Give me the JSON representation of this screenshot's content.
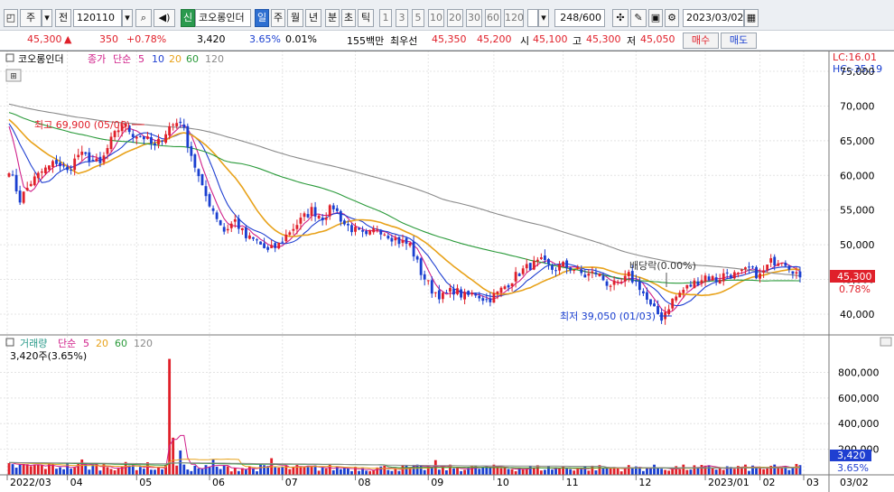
{
  "toolbar": {
    "market_type": "주",
    "prev_label": "전",
    "code": "120110",
    "trust_label": "신",
    "stock_name": "코오롱인더",
    "periods": [
      "일",
      "주",
      "월",
      "년",
      "분",
      "초",
      "틱"
    ],
    "active_period": "일",
    "intervals": [
      "1",
      "3",
      "5",
      "10",
      "20",
      "30",
      "60",
      "120"
    ],
    "count": "248/600",
    "date": "2023/03/02"
  },
  "quote": {
    "price": "45,300",
    "arrow": "▲",
    "change": "350",
    "change_pct": "+0.78%",
    "volume": "3,420",
    "volume_ratio": "3.65%",
    "turnover_pct": "0.01%",
    "trade_value": "155백만",
    "best_label": "최우선",
    "ask": "45,350",
    "bid": "45,200",
    "open_label": "시",
    "open": "45,100",
    "high_label": "고",
    "high": "45,300",
    "low_label": "저",
    "low": "45,050",
    "buy_button": "매수",
    "sell_button": "매도"
  },
  "price_panel": {
    "legend": {
      "name": "코오롱인더",
      "close_label": "종가",
      "ma_label": "단순",
      "ma_periods": [
        "5",
        "10",
        "20",
        "60",
        "120"
      ]
    },
    "lc": "LC:16.01",
    "hc": "HC:-35.19",
    "y_ticks": [
      "75,000",
      "70,000",
      "65,000",
      "60,000",
      "55,000",
      "50,000",
      "45,000",
      "40,000"
    ],
    "current_price": "45,300",
    "current_pct": "0.78%",
    "annotations": {
      "high": "최고 69,900 (05/06)",
      "low": "최저 39,050 (01/03)",
      "dividend": "배당락(0.00%)"
    }
  },
  "volume_panel": {
    "legend": {
      "label": "거래량",
      "ma_label": "단순",
      "ma_periods": [
        "5",
        "20",
        "60",
        "120"
      ]
    },
    "current_volume_text": "3,420주(3.65%)",
    "y_ticks": [
      "800,000",
      "600,000",
      "400,000",
      "200,000"
    ],
    "current_volume": "3,420",
    "current_pct": "3.65%"
  },
  "x_axis": {
    "ticks": [
      "2022/03",
      "04",
      "05",
      "06",
      "07",
      "08",
      "09",
      "10",
      "11",
      "12",
      "2023/01",
      "02",
      "03"
    ],
    "last_date": "03/02"
  },
  "colors": {
    "up": "#e0202a",
    "down": "#1a3fd0",
    "ma5": "#d0208a",
    "ma10": "#1f3fd1",
    "ma20": "#e8a21a",
    "ma60": "#2a9a3a",
    "ma120": "#8a8a8a"
  },
  "chart_data": {
    "type": "candlestick",
    "x": [
      "2022/03",
      "04",
      "05",
      "06",
      "07",
      "08",
      "09",
      "10",
      "11",
      "12",
      "2023/01",
      "02",
      "03"
    ],
    "price_ylim": [
      37000,
      78000
    ],
    "volume_ylim": [
      0,
      930000
    ],
    "close_anchors": [
      {
        "t": 0,
        "v": 61000
      },
      {
        "t": 3,
        "v": 56500
      },
      {
        "t": 6,
        "v": 59000
      },
      {
        "t": 9,
        "v": 60500
      },
      {
        "t": 13,
        "v": 62000
      },
      {
        "t": 16,
        "v": 60500
      },
      {
        "t": 19,
        "v": 63000
      },
      {
        "t": 22,
        "v": 62500
      },
      {
        "t": 25,
        "v": 61500
      },
      {
        "t": 28,
        "v": 65000
      },
      {
        "t": 31,
        "v": 67500
      },
      {
        "t": 34,
        "v": 66000
      },
      {
        "t": 37,
        "v": 65500
      },
      {
        "t": 40,
        "v": 64000
      },
      {
        "t": 44,
        "v": 67000
      },
      {
        "t": 47,
        "v": 68000
      },
      {
        "t": 50,
        "v": 63000
      },
      {
        "t": 53,
        "v": 58000
      },
      {
        "t": 56,
        "v": 55000
      },
      {
        "t": 59,
        "v": 52000
      },
      {
        "t": 62,
        "v": 53500
      },
      {
        "t": 65,
        "v": 51000
      },
      {
        "t": 68,
        "v": 50500
      },
      {
        "t": 71,
        "v": 49000
      },
      {
        "t": 74,
        "v": 50000
      },
      {
        "t": 77,
        "v": 52000
      },
      {
        "t": 80,
        "v": 53500
      },
      {
        "t": 83,
        "v": 55000
      },
      {
        "t": 86,
        "v": 54000
      },
      {
        "t": 89,
        "v": 55500
      },
      {
        "t": 92,
        "v": 53000
      },
      {
        "t": 95,
        "v": 52000
      },
      {
        "t": 98,
        "v": 51000
      },
      {
        "t": 101,
        "v": 52500
      },
      {
        "t": 104,
        "v": 51500
      },
      {
        "t": 107,
        "v": 50500
      },
      {
        "t": 110,
        "v": 50000
      },
      {
        "t": 113,
        "v": 46000
      },
      {
        "t": 116,
        "v": 43500
      },
      {
        "t": 119,
        "v": 42500
      },
      {
        "t": 122,
        "v": 43500
      },
      {
        "t": 125,
        "v": 42500
      },
      {
        "t": 128,
        "v": 43000
      },
      {
        "t": 131,
        "v": 42000
      },
      {
        "t": 134,
        "v": 43000
      },
      {
        "t": 137,
        "v": 44500
      },
      {
        "t": 140,
        "v": 46000
      },
      {
        "t": 143,
        "v": 47000
      },
      {
        "t": 146,
        "v": 47500
      },
      {
        "t": 149,
        "v": 46500
      },
      {
        "t": 152,
        "v": 47000
      },
      {
        "t": 155,
        "v": 46500
      },
      {
        "t": 158,
        "v": 45500
      },
      {
        "t": 161,
        "v": 46000
      },
      {
        "t": 164,
        "v": 44500
      },
      {
        "t": 167,
        "v": 44000
      },
      {
        "t": 170,
        "v": 45500
      },
      {
        "t": 173,
        "v": 44000
      },
      {
        "t": 176,
        "v": 41000
      },
      {
        "t": 179,
        "v": 39500
      },
      {
        "t": 182,
        "v": 42000
      },
      {
        "t": 185,
        "v": 43500
      },
      {
        "t": 188,
        "v": 44500
      },
      {
        "t": 191,
        "v": 45500
      },
      {
        "t": 194,
        "v": 45000
      },
      {
        "t": 197,
        "v": 46000
      },
      {
        "t": 200,
        "v": 45500
      },
      {
        "t": 203,
        "v": 46500
      },
      {
        "t": 206,
        "v": 45500
      },
      {
        "t": 209,
        "v": 47500
      },
      {
        "t": 212,
        "v": 48000
      },
      {
        "t": 215,
        "v": 46500
      },
      {
        "t": 217,
        "v": 45300
      }
    ],
    "sessions": 218,
    "volume_peak": {
      "t": 44,
      "v": 905000
    },
    "volume_spikes": [
      {
        "t": 20,
        "v": 120000
      },
      {
        "t": 45,
        "v": 290000
      },
      {
        "t": 47,
        "v": 190000
      },
      {
        "t": 56,
        "v": 120000
      },
      {
        "t": 72,
        "v": 130000
      },
      {
        "t": 117,
        "v": 115000
      },
      {
        "t": 216,
        "v": 85000
      }
    ],
    "volume_base": 60000,
    "ma_periods": [
      5,
      10,
      20,
      60,
      120
    ]
  }
}
